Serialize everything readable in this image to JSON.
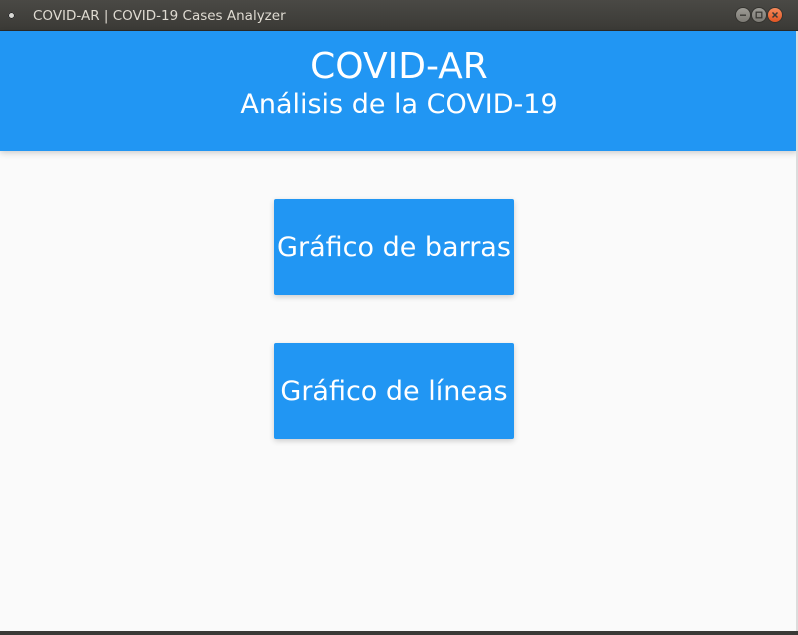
{
  "window": {
    "title": "COVID-AR | COVID-19 Cases Analyzer",
    "controls": {
      "minimize_icon": "minimize-icon",
      "maximize_icon": "maximize-icon",
      "close_icon": "close-icon"
    }
  },
  "header": {
    "title": "COVID-AR",
    "subtitle": "Análisis de la COVID-19"
  },
  "actions": {
    "bar_chart_label": "Gráfico de barras",
    "line_chart_label": "Gráfico de líneas"
  },
  "colors": {
    "primary": "#2196f3",
    "background": "#fafafa",
    "titlebar": "#3b3a36",
    "close_button": "#e25523"
  }
}
